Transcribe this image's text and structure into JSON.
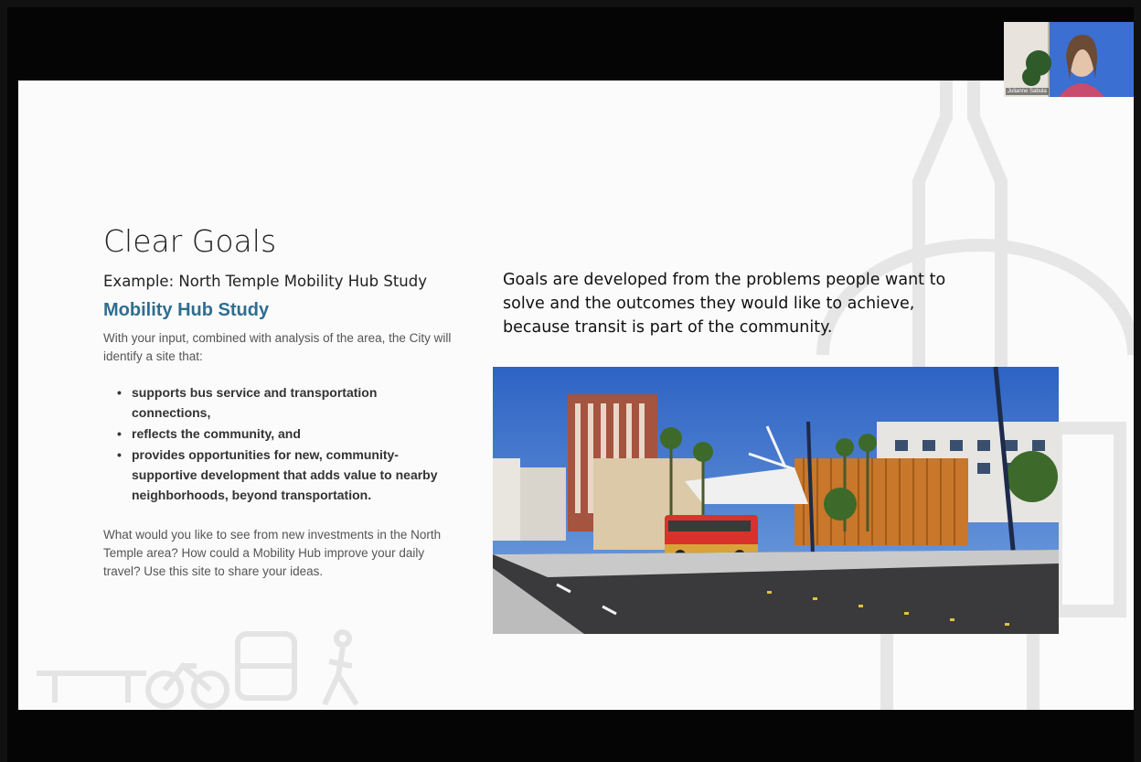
{
  "slide": {
    "title": "Clear Goals",
    "example": "Example: North Temple Mobility Hub Study",
    "hub_title": "Mobility Hub Study",
    "intro": "With your input, combined with analysis of the area, the City will identify a site that:",
    "bullets": [
      "supports bus service and transportation connections,",
      "reflects the community, and",
      "provides opportunities for new, community-supportive development that adds value to nearby neighborhoods, beyond transportation."
    ],
    "question": "What would you like to see from new investments in the North Temple area? How could a Mobility Hub improve your daily travel? Use this site to share your ideas.",
    "goals": "Goals are developed from the problems people want to solve and the outcomes they would like to achieve, because transit is part of the community."
  },
  "participant": {
    "name": "Julianne Sabula"
  },
  "colors": {
    "accent": "#2f6e8f",
    "background": "#fbfbfb",
    "frame": "#050505"
  }
}
